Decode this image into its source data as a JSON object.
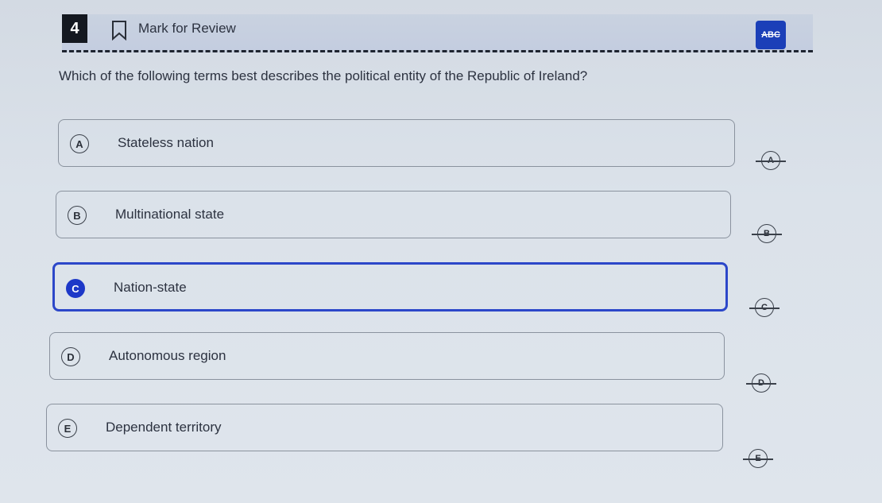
{
  "question_header": {
    "number": "4",
    "mark_label": "Mark for Review",
    "abc_label": "ABC"
  },
  "question": {
    "text": "Which of the following terms best describes the political entity of the Republic of Ireland?"
  },
  "choices": [
    {
      "letter": "A",
      "text": "Stateless nation",
      "selected": false
    },
    {
      "letter": "B",
      "text": "Multinational state",
      "selected": false
    },
    {
      "letter": "C",
      "text": "Nation-state",
      "selected": true
    },
    {
      "letter": "D",
      "text": "Autonomous region",
      "selected": false
    },
    {
      "letter": "E",
      "text": "Dependent territory",
      "selected": false
    }
  ],
  "colors": {
    "accent": "#1d38c8",
    "header_bg": "#c9d2e0",
    "border": "#8a929e"
  },
  "icons": {
    "bookmark": "bookmark-icon",
    "abc": "abc-strikethrough-icon",
    "strike": "eliminate-choice-icon"
  }
}
